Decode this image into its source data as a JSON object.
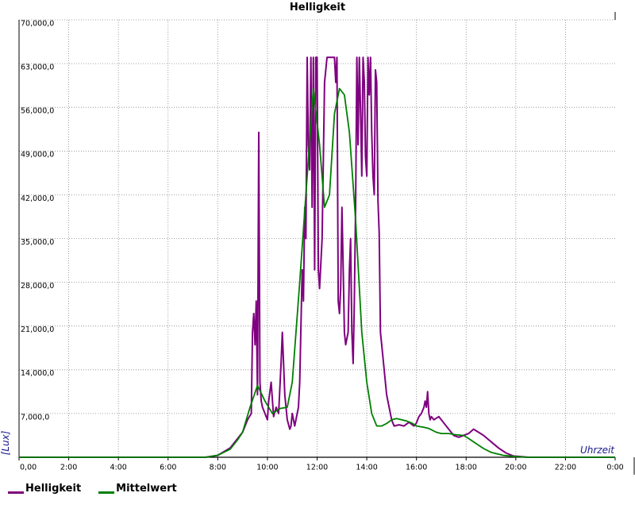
{
  "chart_data": {
    "type": "line",
    "title": "Helligkeit",
    "xlabel": "Uhrzeit",
    "ylabel": "[Lux]",
    "xlim": [
      0,
      24
    ],
    "ylim": [
      0,
      70000
    ],
    "grid": true,
    "legend_position": "bottom-left",
    "x_ticks": [
      "0,00",
      "2:00",
      "4:00",
      "6:00",
      "8:00",
      "10:00",
      "12:00",
      "14:00",
      "16:00",
      "18:00",
      "20:00",
      "22:00",
      "0:00"
    ],
    "y_ticks": [
      "7,000,0",
      "14,000,0",
      "21,000,0",
      "28,000,0",
      "35,000,0",
      "42,000,0",
      "49,000,0",
      "56,000,0",
      "63,000,0",
      "70,000,0"
    ],
    "series": [
      {
        "name": "Helligkeit",
        "color": "#7f007f",
        "points": [
          [
            0,
            0
          ],
          [
            7.5,
            0
          ],
          [
            8.0,
            300
          ],
          [
            8.5,
            1500
          ],
          [
            8.8,
            3000
          ],
          [
            9.0,
            4000
          ],
          [
            9.2,
            6000
          ],
          [
            9.35,
            7000
          ],
          [
            9.4,
            20000
          ],
          [
            9.45,
            23000
          ],
          [
            9.5,
            18000
          ],
          [
            9.55,
            25000
          ],
          [
            9.6,
            10000
          ],
          [
            9.65,
            52000
          ],
          [
            9.7,
            12000
          ],
          [
            9.75,
            9000
          ],
          [
            9.8,
            8000
          ],
          [
            9.9,
            7000
          ],
          [
            10.0,
            6000
          ],
          [
            10.05,
            9000
          ],
          [
            10.15,
            12000
          ],
          [
            10.25,
            6500
          ],
          [
            10.35,
            8000
          ],
          [
            10.45,
            7000
          ],
          [
            10.55,
            15000
          ],
          [
            10.6,
            20000
          ],
          [
            10.7,
            10000
          ],
          [
            10.8,
            6000
          ],
          [
            10.9,
            4500
          ],
          [
            10.95,
            5000
          ],
          [
            11.0,
            7000
          ],
          [
            11.1,
            5000
          ],
          [
            11.25,
            8000
          ],
          [
            11.3,
            12000
          ],
          [
            11.4,
            30000
          ],
          [
            11.45,
            25000
          ],
          [
            11.5,
            40000
          ],
          [
            11.55,
            35000
          ],
          [
            11.6,
            64000
          ],
          [
            11.65,
            50000
          ],
          [
            11.7,
            46000
          ],
          [
            11.75,
            64000
          ],
          [
            11.8,
            40000
          ],
          [
            11.85,
            64000
          ],
          [
            11.9,
            30000
          ],
          [
            11.95,
            64000
          ],
          [
            12.0,
            64000
          ],
          [
            12.05,
            30000
          ],
          [
            12.1,
            27000
          ],
          [
            12.2,
            35000
          ],
          [
            12.3,
            60000
          ],
          [
            12.4,
            64000
          ],
          [
            12.5,
            64000
          ],
          [
            12.55,
            64000
          ],
          [
            12.6,
            64000
          ],
          [
            12.7,
            64000
          ],
          [
            12.75,
            60000
          ],
          [
            12.8,
            64000
          ],
          [
            12.85,
            25000
          ],
          [
            12.9,
            23000
          ],
          [
            12.95,
            27000
          ],
          [
            13.0,
            40000
          ],
          [
            13.05,
            30000
          ],
          [
            13.1,
            20000
          ],
          [
            13.15,
            18000
          ],
          [
            13.25,
            20000
          ],
          [
            13.3,
            30000
          ],
          [
            13.35,
            35000
          ],
          [
            13.4,
            20000
          ],
          [
            13.45,
            15000
          ],
          [
            13.5,
            25000
          ],
          [
            13.55,
            40000
          ],
          [
            13.6,
            64000
          ],
          [
            13.65,
            50000
          ],
          [
            13.7,
            64000
          ],
          [
            13.75,
            55000
          ],
          [
            13.8,
            45000
          ],
          [
            13.85,
            64000
          ],
          [
            13.9,
            60000
          ],
          [
            13.95,
            48000
          ],
          [
            14.0,
            45000
          ],
          [
            14.05,
            64000
          ],
          [
            14.1,
            58000
          ],
          [
            14.15,
            64000
          ],
          [
            14.2,
            52000
          ],
          [
            14.25,
            45000
          ],
          [
            14.3,
            42000
          ],
          [
            14.35,
            62000
          ],
          [
            14.4,
            60000
          ],
          [
            14.45,
            41000
          ],
          [
            14.5,
            36000
          ],
          [
            14.55,
            20000
          ],
          [
            14.6,
            18000
          ],
          [
            14.7,
            14000
          ],
          [
            14.8,
            10000
          ],
          [
            15.0,
            6000
          ],
          [
            15.1,
            5000
          ],
          [
            15.3,
            5200
          ],
          [
            15.5,
            5000
          ],
          [
            15.7,
            5600
          ],
          [
            15.9,
            5000
          ],
          [
            16.0,
            5500
          ],
          [
            16.05,
            6000
          ],
          [
            16.1,
            6500
          ],
          [
            16.2,
            7000
          ],
          [
            16.3,
            8000
          ],
          [
            16.35,
            9000
          ],
          [
            16.4,
            8000
          ],
          [
            16.45,
            10500
          ],
          [
            16.5,
            7000
          ],
          [
            16.55,
            6000
          ],
          [
            16.6,
            6500
          ],
          [
            16.7,
            6000
          ],
          [
            16.9,
            6500
          ],
          [
            17.1,
            5500
          ],
          [
            17.3,
            4500
          ],
          [
            17.5,
            3500
          ],
          [
            17.7,
            3200
          ],
          [
            17.9,
            3500
          ],
          [
            18.1,
            3800
          ],
          [
            18.3,
            4500
          ],
          [
            18.5,
            4000
          ],
          [
            18.7,
            3500
          ],
          [
            19.0,
            2500
          ],
          [
            19.3,
            1500
          ],
          [
            19.6,
            700
          ],
          [
            19.9,
            200
          ],
          [
            20.5,
            0
          ],
          [
            24,
            0
          ]
        ]
      },
      {
        "name": "Mittelwert",
        "color": "#007f00",
        "points": [
          [
            0,
            0
          ],
          [
            7.5,
            0
          ],
          [
            8.0,
            300
          ],
          [
            8.5,
            1300
          ],
          [
            8.8,
            2800
          ],
          [
            9.0,
            4000
          ],
          [
            9.3,
            8000
          ],
          [
            9.6,
            11500
          ],
          [
            9.9,
            9000
          ],
          [
            10.2,
            7000
          ],
          [
            10.5,
            7800
          ],
          [
            10.8,
            8000
          ],
          [
            11.0,
            12000
          ],
          [
            11.3,
            28000
          ],
          [
            11.6,
            45000
          ],
          [
            11.85,
            59000
          ],
          [
            12.1,
            50000
          ],
          [
            12.3,
            40000
          ],
          [
            12.5,
            42000
          ],
          [
            12.7,
            55000
          ],
          [
            12.9,
            59000
          ],
          [
            13.1,
            58000
          ],
          [
            13.3,
            52000
          ],
          [
            13.55,
            38000
          ],
          [
            13.8,
            20000
          ],
          [
            14.0,
            12000
          ],
          [
            14.2,
            7000
          ],
          [
            14.4,
            5000
          ],
          [
            14.6,
            5000
          ],
          [
            14.8,
            5400
          ],
          [
            15.0,
            6000
          ],
          [
            15.2,
            6200
          ],
          [
            15.4,
            6000
          ],
          [
            15.6,
            5800
          ],
          [
            15.8,
            5500
          ],
          [
            16.0,
            5000
          ],
          [
            16.3,
            4800
          ],
          [
            16.5,
            4600
          ],
          [
            16.8,
            4000
          ],
          [
            17.0,
            3800
          ],
          [
            17.3,
            3800
          ],
          [
            17.6,
            3600
          ],
          [
            17.9,
            3500
          ],
          [
            18.1,
            3000
          ],
          [
            18.4,
            2200
          ],
          [
            18.7,
            1400
          ],
          [
            19.0,
            800
          ],
          [
            19.5,
            300
          ],
          [
            20.0,
            100
          ],
          [
            20.5,
            0
          ],
          [
            24,
            0
          ]
        ]
      }
    ]
  }
}
